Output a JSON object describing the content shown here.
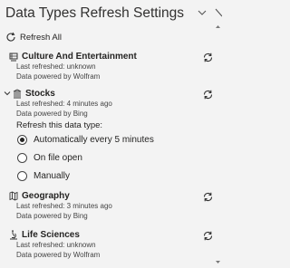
{
  "pane": {
    "title": "Data Types Refresh Settings",
    "refresh_all_label": "Refresh All"
  },
  "items": [
    {
      "name": "Culture And Entertainment",
      "last_refreshed": "Last refreshed: unknown",
      "powered_by": "Data powered by Wolfram",
      "icon": "culture-icon"
    },
    {
      "name": "Stocks",
      "last_refreshed": "Last refreshed: 4 minutes ago",
      "powered_by": "Data powered by Bing",
      "icon": "stocks-icon",
      "expanded": true,
      "refresh_section_title": "Refresh this data type:",
      "options": [
        {
          "label": "Automatically every 5 minutes",
          "selected": true
        },
        {
          "label": "On file open",
          "selected": false
        },
        {
          "label": "Manually",
          "selected": false
        }
      ]
    },
    {
      "name": "Geography",
      "last_refreshed": "Last refreshed: 3 minutes ago",
      "powered_by": "Data powered by Bing",
      "icon": "geography-icon"
    },
    {
      "name": "Life Sciences",
      "last_refreshed": "Last refreshed: unknown",
      "powered_by": "Data powered by Wolfram",
      "icon": "life-sciences-icon"
    }
  ]
}
